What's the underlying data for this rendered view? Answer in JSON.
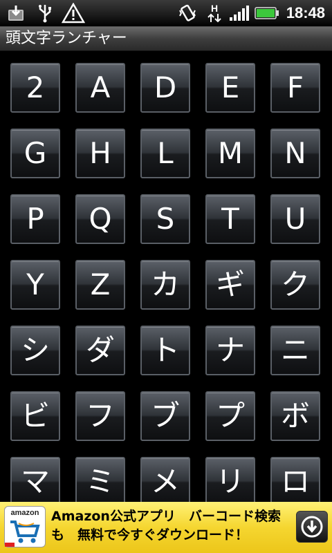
{
  "status_bar": {
    "time": "18:48",
    "network_label": "H",
    "icons": [
      "download-notification-icon",
      "usb-icon",
      "warning-icon",
      "vibrate-icon",
      "network-h-icon",
      "signal-icon",
      "battery-icon"
    ]
  },
  "app": {
    "title": "頭文字ランチャー"
  },
  "keys": [
    "2",
    "A",
    "D",
    "E",
    "F",
    "G",
    "H",
    "L",
    "M",
    "N",
    "P",
    "Q",
    "S",
    "T",
    "U",
    "Y",
    "Z",
    "カ",
    "ギ",
    "ク",
    "シ",
    "ダ",
    "ト",
    "ナ",
    "ニ",
    "ビ",
    "フ",
    "ブ",
    "プ",
    "ボ",
    "マ",
    "ミ",
    "メ",
    "リ",
    "ロ"
  ],
  "ad": {
    "logo_text": "amazon",
    "line1": "Amazon公式アプリ　バーコード検索",
    "line2": "も　無料で今すぐダウンロード！"
  },
  "colors": {
    "battery": "#3cc83c",
    "ad_background": "#f5d630"
  }
}
